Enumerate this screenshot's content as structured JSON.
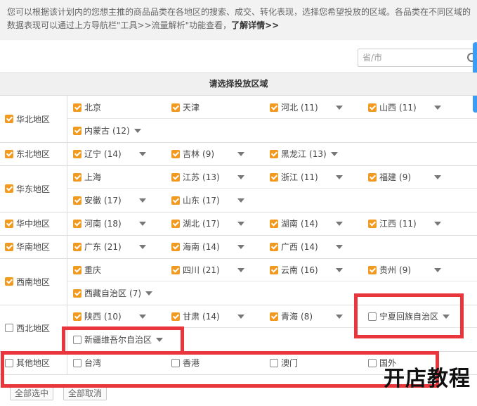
{
  "intro": {
    "text": "您可以根据该计划内的您想主推的商品品类在各地区的搜索、成交、转化表现，选择您希望投放的区域。各品类在不同区域的数据表现可以通过上方导航栏\"工具>>流量解析\"功能查看，",
    "link": "了解详情>>"
  },
  "search": {
    "placeholder": "省/市"
  },
  "table": {
    "header": "请选择投放区域"
  },
  "groups": [
    {
      "label": "华北地区",
      "checked": true,
      "rows": [
        [
          {
            "name": "北京",
            "count": "",
            "checked": true,
            "dropdown": false
          },
          {
            "name": "天津",
            "count": "",
            "checked": true,
            "dropdown": false
          },
          {
            "name": "河北",
            "count": "(11)",
            "checked": true,
            "dropdown": true
          },
          {
            "name": "山西",
            "count": "(11)",
            "checked": true,
            "dropdown": true
          }
        ],
        [
          {
            "name": "内蒙古",
            "count": "(12)",
            "checked": true,
            "dropdown": true,
            "near": true
          }
        ]
      ]
    },
    {
      "label": "东北地区",
      "checked": true,
      "rows": [
        [
          {
            "name": "辽宁",
            "count": "(14)",
            "checked": true,
            "dropdown": true
          },
          {
            "name": "吉林",
            "count": "(9)",
            "checked": true,
            "dropdown": true
          },
          {
            "name": "黑龙江",
            "count": "(13)",
            "checked": true,
            "dropdown": true,
            "near": true
          }
        ]
      ]
    },
    {
      "label": "华东地区",
      "checked": true,
      "rows": [
        [
          {
            "name": "上海",
            "count": "",
            "checked": true,
            "dropdown": false
          },
          {
            "name": "江苏",
            "count": "(13)",
            "checked": true,
            "dropdown": true
          },
          {
            "name": "浙江",
            "count": "(11)",
            "checked": true,
            "dropdown": true
          },
          {
            "name": "福建",
            "count": "(9)",
            "checked": true,
            "dropdown": true
          }
        ],
        [
          {
            "name": "安徽",
            "count": "(17)",
            "checked": true,
            "dropdown": true
          },
          {
            "name": "山东",
            "count": "(17)",
            "checked": true,
            "dropdown": true
          }
        ]
      ]
    },
    {
      "label": "华中地区",
      "checked": true,
      "rows": [
        [
          {
            "name": "河南",
            "count": "(18)",
            "checked": true,
            "dropdown": true
          },
          {
            "name": "湖北",
            "count": "(17)",
            "checked": true,
            "dropdown": true
          },
          {
            "name": "湖南",
            "count": "(14)",
            "checked": true,
            "dropdown": true
          },
          {
            "name": "江西",
            "count": "(11)",
            "checked": true,
            "dropdown": true
          }
        ]
      ]
    },
    {
      "label": "华南地区",
      "checked": true,
      "rows": [
        [
          {
            "name": "广东",
            "count": "(21)",
            "checked": true,
            "dropdown": true
          },
          {
            "name": "海南",
            "count": "(14)",
            "checked": true,
            "dropdown": true
          },
          {
            "name": "广西",
            "count": "(14)",
            "checked": true,
            "dropdown": true
          }
        ]
      ]
    },
    {
      "label": "西南地区",
      "checked": true,
      "rows": [
        [
          {
            "name": "重庆",
            "count": "",
            "checked": true,
            "dropdown": false
          },
          {
            "name": "四川",
            "count": "(21)",
            "checked": true,
            "dropdown": true
          },
          {
            "name": "云南",
            "count": "(16)",
            "checked": true,
            "dropdown": true
          },
          {
            "name": "贵州",
            "count": "(9)",
            "checked": true,
            "dropdown": true
          }
        ],
        [
          {
            "name": "西藏自治区",
            "count": "(7)",
            "checked": true,
            "dropdown": true,
            "near": true
          }
        ]
      ]
    },
    {
      "label": "西北地区",
      "checked": false,
      "rows": [
        [
          {
            "name": "陕西",
            "count": "(10)",
            "checked": true,
            "dropdown": true
          },
          {
            "name": "甘肃",
            "count": "(14)",
            "checked": true,
            "dropdown": true
          },
          {
            "name": "青海",
            "count": "(8)",
            "checked": true,
            "dropdown": true
          },
          {
            "name": "宁夏回族自治区",
            "count": "",
            "checked": false,
            "dropdown": true,
            "near": true
          }
        ],
        [
          {
            "name": "新疆维吾尔自治区",
            "count": "",
            "checked": false,
            "dropdown": true,
            "near": true
          }
        ]
      ]
    },
    {
      "label": "其他地区",
      "checked": false,
      "rows": [
        [
          {
            "name": "台湾",
            "count": "",
            "checked": false,
            "dropdown": false
          },
          {
            "name": "香港",
            "count": "",
            "checked": false,
            "dropdown": false
          },
          {
            "name": "澳门",
            "count": "",
            "checked": false,
            "dropdown": false
          },
          {
            "name": "国外",
            "count": "",
            "checked": false,
            "dropdown": false
          }
        ]
      ]
    }
  ],
  "buttons": {
    "select_all": "全部选中",
    "cancel_all": "全部取消"
  },
  "watermark": "开店教程",
  "colors": {
    "checkbox_on": "#f29a1f",
    "highlight": "#e8363c",
    "scroll_accent": "#3b9cf5"
  }
}
